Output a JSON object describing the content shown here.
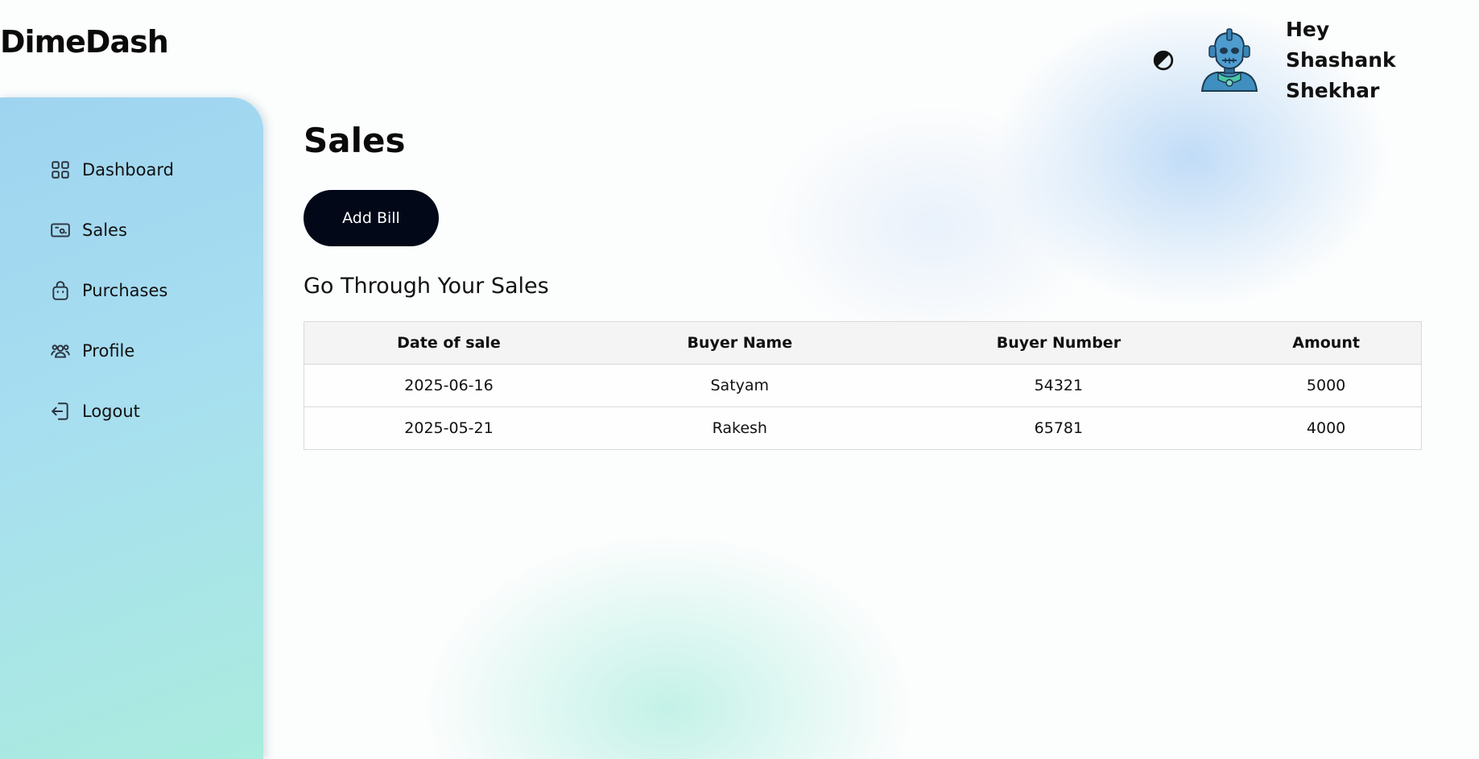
{
  "brand": {
    "name": "DimeDash"
  },
  "topbar": {
    "theme_toggle_icon": "contrast-icon",
    "avatar_icon": "robot-avatar-icon",
    "greeting": "Hey Shashank Shekhar"
  },
  "sidebar": {
    "items": [
      {
        "label": "Dashboard",
        "icon": "grid-icon"
      },
      {
        "label": "Sales",
        "icon": "banknote-icon"
      },
      {
        "label": "Purchases",
        "icon": "shopping-bag-icon"
      },
      {
        "label": "Profile",
        "icon": "users-icon"
      },
      {
        "label": "Logout",
        "icon": "logout-icon"
      }
    ],
    "colors": {
      "gradient_top": "#9fd4f0",
      "gradient_bottom": "#aaecde"
    }
  },
  "main": {
    "title": "Sales",
    "add_bill_label": "Add Bill",
    "section_title": "Go Through Your Sales",
    "table": {
      "headers": [
        "Date of sale",
        "Buyer Name",
        "Buyer Number",
        "Amount"
      ],
      "rows": [
        [
          "2025-06-16",
          "Satyam",
          "54321",
          "5000"
        ],
        [
          "2025-05-21",
          "Rakesh",
          "65781",
          "4000"
        ]
      ]
    }
  },
  "colors": {
    "button_bg": "#020817",
    "button_text": "#ffffff"
  }
}
